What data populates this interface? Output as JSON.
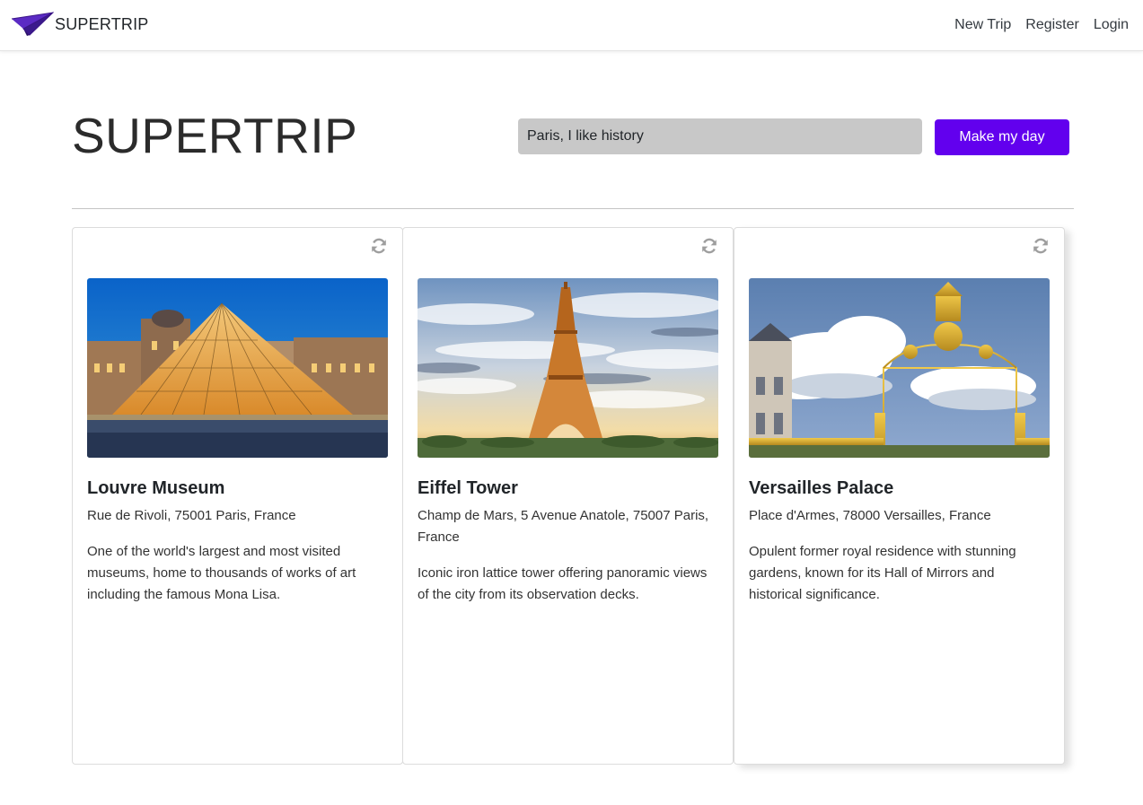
{
  "navbar": {
    "brand": "SUPERTRIP",
    "links": [
      "New Trip",
      "Register",
      "Login"
    ]
  },
  "hero": {
    "title": "SUPERTRIP",
    "search_value": "Paris, I like history",
    "button_label": "Make my day"
  },
  "colors": {
    "accent": "#6200ee",
    "input_bg": "#c8c8c8"
  },
  "cards": [
    {
      "title": "Louvre Museum",
      "address": "Rue de Rivoli, 75001 Paris, France",
      "description": "One of the world's largest and most visited museums, home to thousands of works of art including the famous Mona Lisa.",
      "image": "louvre-pyramid-photo"
    },
    {
      "title": "Eiffel Tower",
      "address": "Champ de Mars, 5 Avenue Anatole, 75007 Paris, France",
      "description": "Iconic iron lattice tower offering panoramic views of the city from its observation decks.",
      "image": "eiffel-tower-photo"
    },
    {
      "title": "Versailles Palace",
      "address": "Place d'Armes, 78000 Versailles, France",
      "description": "Opulent former royal residence with stunning gardens, known for its Hall of Mirrors and historical significance.",
      "image": "versailles-gate-photo"
    }
  ]
}
